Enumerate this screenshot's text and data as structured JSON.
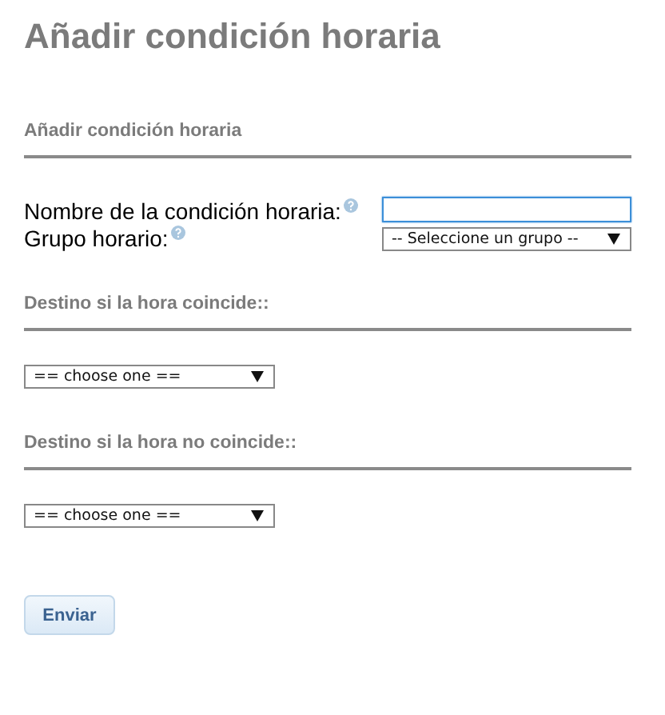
{
  "title": "Añadir condición horaria",
  "sections": [
    {
      "heading": "Añadir condición horaria",
      "fields": [
        {
          "kind": "text",
          "label": "Nombre de la condición horaria:",
          "focused": true
        },
        {
          "kind": "select",
          "label": "Grupo horario:",
          "value": "-- Seleccione un grupo --"
        }
      ]
    },
    {
      "heading": "Destino si la hora coincide::",
      "fields": [
        {
          "kind": "select",
          "value": "== choose one =="
        }
      ]
    },
    {
      "heading": "Destino si la hora no coincide::",
      "fields": [
        {
          "kind": "select",
          "value": "== choose one =="
        }
      ]
    }
  ],
  "submit": "Enviar"
}
